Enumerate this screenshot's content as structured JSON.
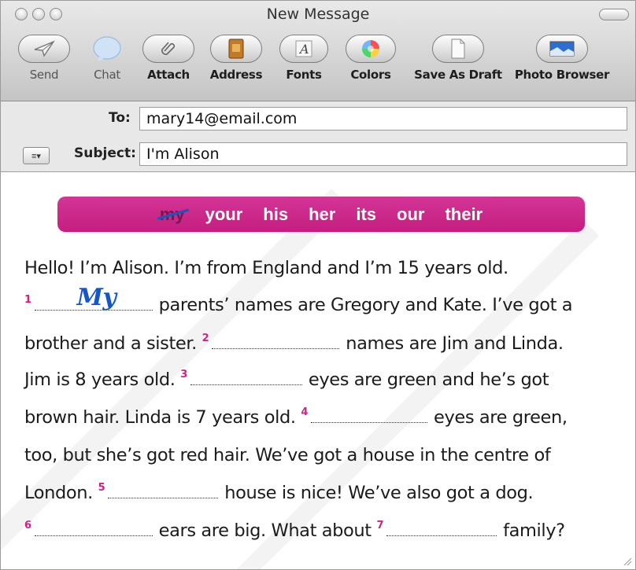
{
  "window": {
    "title": "New Message"
  },
  "toolbar": {
    "send": "Send",
    "chat": "Chat",
    "attach": "Attach",
    "address": "Address",
    "fonts": "Fonts",
    "colors": "Colors",
    "save_as_draft": "Save As Draft",
    "photo_browser": "Photo Browser"
  },
  "header": {
    "to_label": "To:",
    "to_value": "mary14@email.com",
    "subject_label": "Subject:",
    "subject_value": "I'm Alison",
    "menu_glyph": "≡▾"
  },
  "wordbox": [
    "my",
    "your",
    "his",
    "her",
    "its",
    "our",
    "their"
  ],
  "lines": {
    "l1": "Hello! I’m Alison. I’m from England and I’m 15 years old.",
    "l2_num": "1",
    "l2_answer": "My",
    "l2_text": "parents’ names are Gregory and Kate. I’ve got a",
    "l3_pre": "brother and a sister.",
    "l3_num": "2",
    "l3_post": "names are Jim and Linda.",
    "l4_pre": "Jim is 8 years old.",
    "l4_num": "3",
    "l4_post": "eyes are green and he’s got",
    "l5_pre": "brown hair. Linda is 7 years old.",
    "l5_num": "4",
    "l5_post": "eyes are green,",
    "l6": "too, but she’s got red hair. We’ve got a house in the centre of",
    "l7_pre": "London.",
    "l7_num": "5",
    "l7_post": "house is nice! We’ve also got a dog.",
    "l8_num": "6",
    "l8_mid": "ears are big. What about",
    "l8_num2": "7",
    "l8_post": "family?"
  },
  "icons": {
    "send": "paper-plane-icon",
    "chat": "speech-bubble-icon",
    "attach": "paperclip-icon",
    "address": "address-book-icon",
    "fonts": "font-icon",
    "colors": "color-wheel-icon",
    "save_as_draft": "document-icon",
    "photo_browser": "photo-icon"
  },
  "colors": {
    "accent": "#c8288a",
    "answer": "#1556c8"
  }
}
